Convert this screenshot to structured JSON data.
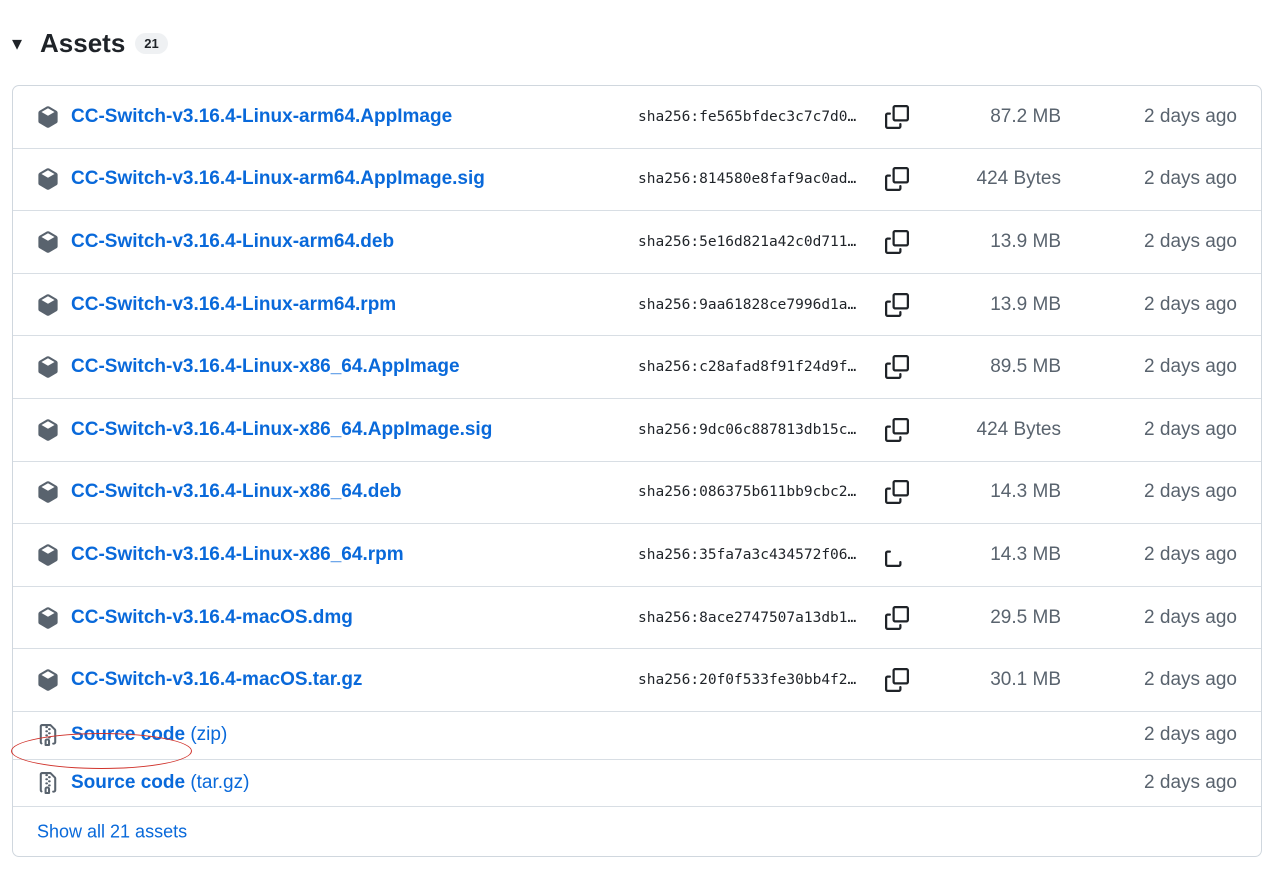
{
  "header": {
    "caret": "▾",
    "title": "Assets",
    "count": "21"
  },
  "assets": [
    {
      "name": "CC-Switch-v3.16.4-Linux-arm64.AppImage",
      "sha": "sha256:fe565bfdec3c7c7d0…",
      "size": "87.2 MB",
      "date": "2 days ago"
    },
    {
      "name": "CC-Switch-v3.16.4-Linux-arm64.AppImage.sig",
      "sha": "sha256:814580e8faf9ac0ad…",
      "size": "424 Bytes",
      "date": "2 days ago"
    },
    {
      "name": "CC-Switch-v3.16.4-Linux-arm64.deb",
      "sha": "sha256:5e16d821a42c0d711…",
      "size": "13.9 MB",
      "date": "2 days ago"
    },
    {
      "name": "CC-Switch-v3.16.4-Linux-arm64.rpm",
      "sha": "sha256:9aa61828ce7996d1a…",
      "size": "13.9 MB",
      "date": "2 days ago"
    },
    {
      "name": "CC-Switch-v3.16.4-Linux-x86_64.AppImage",
      "sha": "sha256:c28afad8f91f24d9f…",
      "size": "89.5 MB",
      "date": "2 days ago"
    },
    {
      "name": "CC-Switch-v3.16.4-Linux-x86_64.AppImage.sig",
      "sha": "sha256:9dc06c887813db15c…",
      "size": "424 Bytes",
      "date": "2 days ago"
    },
    {
      "name": "CC-Switch-v3.16.4-Linux-x86_64.deb",
      "sha": "sha256:086375b611bb9cbc2…",
      "size": "14.3 MB",
      "date": "2 days ago"
    },
    {
      "name": "CC-Switch-v3.16.4-Linux-x86_64.rpm",
      "sha": "sha256:35fa7a3c434572f06…",
      "size": "14.3 MB",
      "date": "2 days ago"
    },
    {
      "name": "CC-Switch-v3.16.4-macOS.dmg",
      "sha": "sha256:8ace2747507a13db1…",
      "size": "29.5 MB",
      "date": "2 days ago"
    },
    {
      "name": "CC-Switch-v3.16.4-macOS.tar.gz",
      "sha": "sha256:20f0f533fe30bb4f2…",
      "size": "30.1 MB",
      "date": "2 days ago"
    }
  ],
  "source": [
    {
      "label": "Source code",
      "format": "(zip)",
      "date": "2 days ago"
    },
    {
      "label": "Source code",
      "format": "(tar.gz)",
      "date": "2 days ago"
    }
  ],
  "footer": {
    "show_all": "Show all 21 assets"
  },
  "icons": {
    "asset": "package-icon",
    "source": "file-zip-icon",
    "copy": "copy-icon"
  },
  "colors": {
    "link": "#0969da",
    "muted": "#59636e",
    "border": "#d0d7de",
    "annotation": "#d0322b"
  }
}
